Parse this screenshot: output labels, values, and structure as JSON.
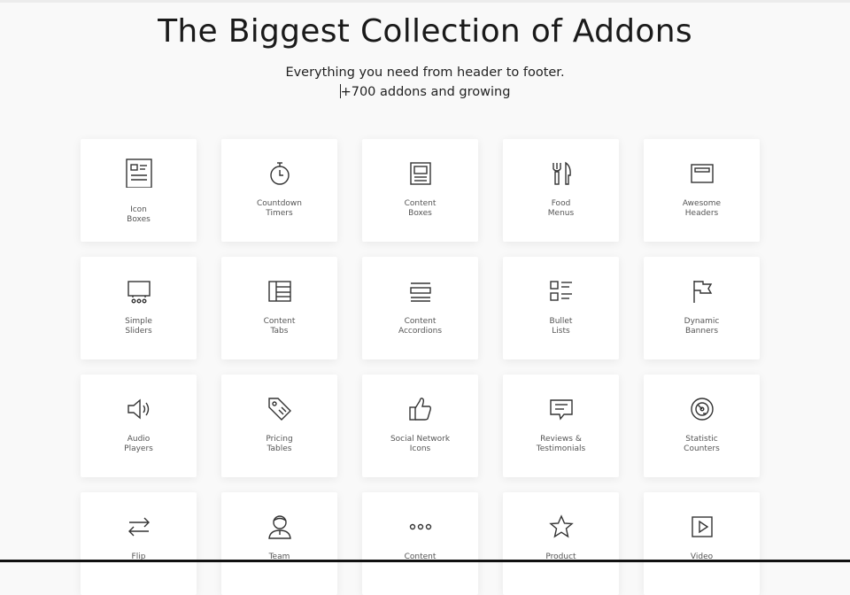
{
  "header": {
    "title": "The Biggest Collection of Addons",
    "subtitle_line1": "Everything you need from header to footer.",
    "subtitle_line2": "+700 addons and growing"
  },
  "cards": [
    {
      "line1": "Icon",
      "line2": "Boxes",
      "icon": "icon-box-icon"
    },
    {
      "line1": "Countdown",
      "line2": "Timers",
      "icon": "stopwatch-icon"
    },
    {
      "line1": "Content",
      "line2": "Boxes",
      "icon": "content-box-icon"
    },
    {
      "line1": "Food",
      "line2": "Menus",
      "icon": "fork-knife-icon"
    },
    {
      "line1": "Awesome",
      "line2": "Headers",
      "icon": "header-window-icon"
    },
    {
      "line1": "Simple",
      "line2": "Sliders",
      "icon": "slider-icon"
    },
    {
      "line1": "Content",
      "line2": "Tabs",
      "icon": "tabs-icon"
    },
    {
      "line1": "Content",
      "line2": "Accordions",
      "icon": "accordion-icon"
    },
    {
      "line1": "Bullet",
      "line2": "Lists",
      "icon": "bullet-list-icon"
    },
    {
      "line1": "Dynamic",
      "line2": "Banners",
      "icon": "flag-icon"
    },
    {
      "line1": "Audio",
      "line2": "Players",
      "icon": "speaker-icon"
    },
    {
      "line1": "Pricing",
      "line2": "Tables",
      "icon": "price-tag-icon"
    },
    {
      "line1": "Social Network",
      "line2": "Icons",
      "icon": "thumbs-up-icon"
    },
    {
      "line1": "Reviews &",
      "line2": "Testimonials",
      "icon": "comment-icon"
    },
    {
      "line1": "Statistic",
      "line2": "Counters",
      "icon": "gauge-icon"
    },
    {
      "line1": "Flip",
      "line2": "",
      "icon": "swap-arrows-icon"
    },
    {
      "line1": "Team",
      "line2": "",
      "icon": "person-icon"
    },
    {
      "line1": "Content",
      "line2": "",
      "icon": "dots-icon"
    },
    {
      "line1": "Product",
      "line2": "",
      "icon": "star-icon"
    },
    {
      "line1": "Video",
      "line2": "",
      "icon": "play-icon"
    }
  ]
}
